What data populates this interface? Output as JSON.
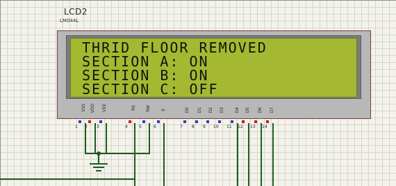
{
  "component": {
    "name": "LCD2",
    "model": "LM044L"
  },
  "lcd": {
    "lines": [
      "THRID FLOOR REMOVED",
      "SECTION A: ON",
      "SECTION B: ON",
      "SECTION C: OFF"
    ],
    "colors": {
      "screen": "#a5b832",
      "text": "#10140a"
    }
  },
  "pins": [
    {
      "label": "VSS",
      "num": "1"
    },
    {
      "label": "VDD",
      "num": "2"
    },
    {
      "label": "VEE",
      "num": "3"
    },
    {
      "label": "RS",
      "num": "4"
    },
    {
      "label": "RW",
      "num": "5"
    },
    {
      "label": "E",
      "num": "6"
    },
    {
      "label": "D0",
      "num": "7"
    },
    {
      "label": "D1",
      "num": "8"
    },
    {
      "label": "D2",
      "num": "9"
    },
    {
      "label": "D3",
      "num": "10"
    },
    {
      "label": "D4",
      "num": "11"
    },
    {
      "label": "D5",
      "num": "12"
    },
    {
      "label": "D6",
      "num": "13"
    },
    {
      "label": "D7",
      "num": "14"
    }
  ],
  "colors": {
    "wire": "#1f5a1f",
    "pin_blue": "#2d3fc0",
    "pin_red": "#c02020"
  },
  "icons": {
    "ground": "ground-symbol-icon",
    "junction": "junction-dot-icon"
  }
}
